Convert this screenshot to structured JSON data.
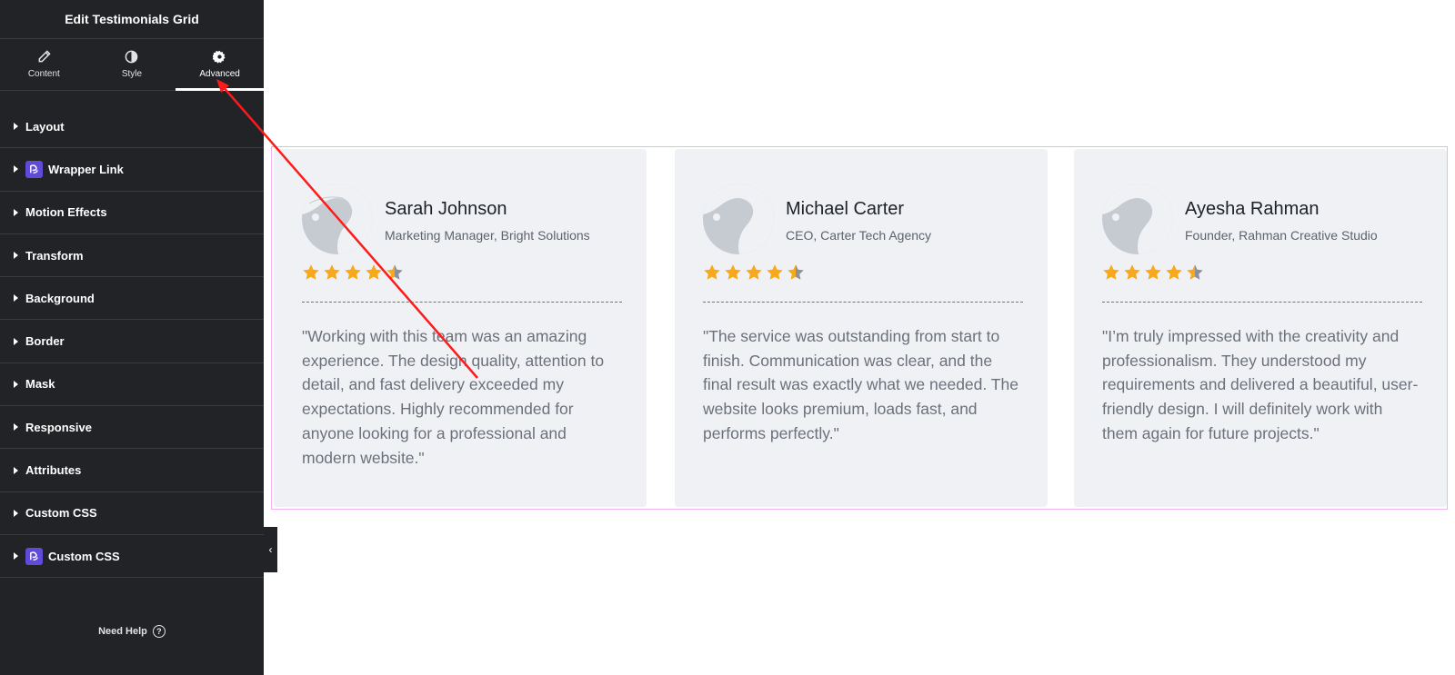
{
  "panel": {
    "title": "Edit Testimonials Grid",
    "tabs": [
      {
        "label": "Content",
        "icon": "pencil-icon"
      },
      {
        "label": "Style",
        "icon": "contrast-icon"
      },
      {
        "label": "Advanced",
        "icon": "gear-icon",
        "active": true
      }
    ],
    "sections": [
      {
        "label": "Layout"
      },
      {
        "label": "Wrapper Link",
        "badge": "plugin-logo-icon"
      },
      {
        "label": "Motion Effects"
      },
      {
        "label": "Transform"
      },
      {
        "label": "Background"
      },
      {
        "label": "Border"
      },
      {
        "label": "Mask"
      },
      {
        "label": "Responsive"
      },
      {
        "label": "Attributes"
      },
      {
        "label": "Custom CSS"
      },
      {
        "label": "Custom CSS",
        "badge": "plugin-logo-icon"
      }
    ],
    "help_label": "Need Help",
    "collapse_glyph": "‹"
  },
  "testimonials": [
    {
      "name": "Sarah Johnson",
      "role": "Marketing Manager, Bright Solutions",
      "rating": 4.5,
      "quote": "\"Working with this team was an amazing experience. The design quality, attention to detail, and fast delivery exceeded my expectations. Highly recommended for anyone looking for a professional and modern website.\""
    },
    {
      "name": "Michael Carter",
      "role": "CEO, Carter Tech Agency",
      "rating": 4.5,
      "quote": "\"The service was outstanding from start to finish. Communication was clear, and the final result was exactly what we needed. The website looks premium, loads fast, and performs perfectly.\""
    },
    {
      "name": "Ayesha Rahman",
      "role": "Founder, Rahman Creative Studio",
      "rating": 4.5,
      "quote": "\"I’m truly impressed with the creativity and professionalism. They understood my requirements and delivered a beautiful, user-friendly design. I will definitely work with them again for future projects.\""
    }
  ],
  "colors": {
    "sidebar_bg": "#212326",
    "card_bg": "#f0f1f5",
    "star_filled": "#f8a91b",
    "star_empty": "#8b9099",
    "grid_outline": "#f2b2ef",
    "annotation_arrow": "#ff0000",
    "plugin_badge": "#5f4bd8"
  }
}
